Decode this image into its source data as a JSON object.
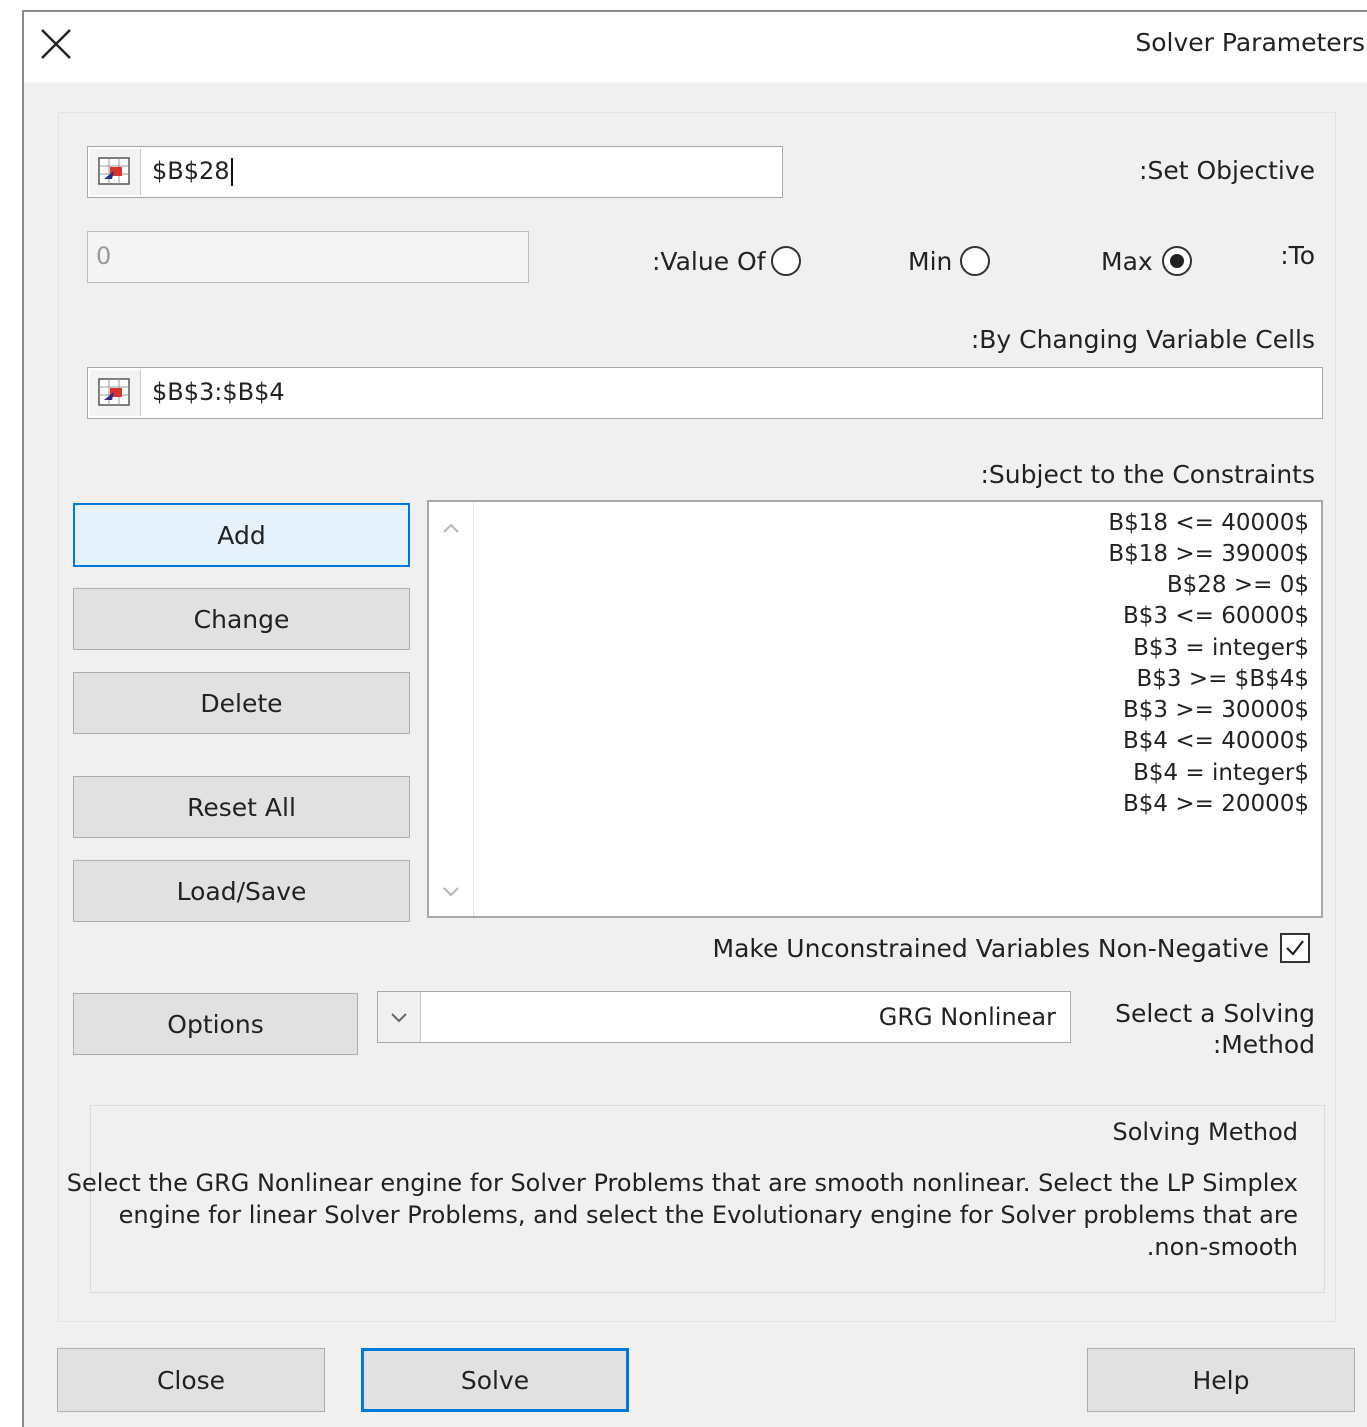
{
  "window": {
    "title": "Solver Parameters",
    "close_icon": "close-icon"
  },
  "objective": {
    "label": ":Set Objective",
    "value": "$B$28"
  },
  "to": {
    "label": ":To",
    "max_label": "Max",
    "min_label": "Min",
    "value_of_label": ":Value Of",
    "value_of_value": "0",
    "selected": "max"
  },
  "variables": {
    "label": ":By Changing Variable Cells",
    "value": "$B$3:$B$4"
  },
  "constraints": {
    "label": ":Subject to the Constraints",
    "items": [
      "B$18 <= 40000$",
      "B$18 >= 39000$",
      "B$28 >= 0$",
      "B$3 <= 60000$",
      "B$3 = integer$",
      "B$3 >= $B$4$",
      "B$3 >= 30000$",
      "B$4 <= 40000$",
      "B$4 = integer$",
      "B$4 >= 20000$"
    ]
  },
  "buttons": {
    "add": "Add",
    "change": "Change",
    "delete": "Delete",
    "reset_all": "Reset All",
    "load_save": "Load/Save",
    "options": "Options",
    "close": "Close",
    "solve": "Solve",
    "help": "Help"
  },
  "nonnegative": {
    "label": "Make Unconstrained Variables Non-Negative",
    "checked": true
  },
  "method": {
    "label_line1": "Select a Solving",
    "label_line2": ":Method",
    "selected": "GRG Nonlinear"
  },
  "description": {
    "heading": "Solving Method",
    "line1": "Select the GRG Nonlinear engine for Solver Problems that are smooth nonlinear. Select the LP Simplex",
    "line2": "engine for linear Solver Problems, and select the Evolutionary engine for Solver problems that are",
    "line3": ".non-smooth"
  },
  "colors": {
    "dialog_bg": "#f0f0f0",
    "accent": "#0078d7",
    "button_bg": "#e1e1e1"
  }
}
